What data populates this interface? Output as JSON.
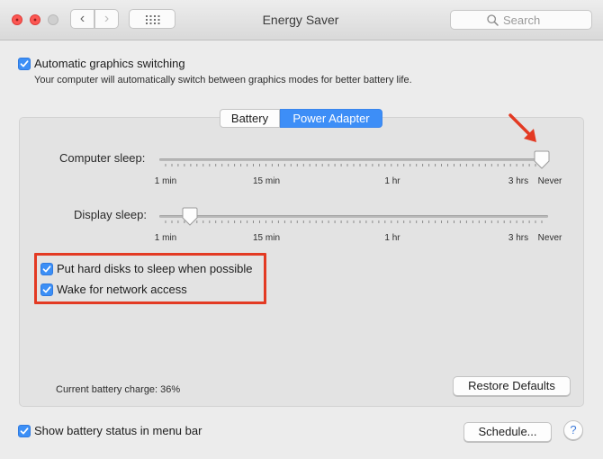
{
  "window": {
    "title": "Energy Saver",
    "search_placeholder": "Search"
  },
  "toolbar": {
    "back_glyph": "‹",
    "forward_glyph": "›",
    "grid_icon": "show-all-grid-icon"
  },
  "graphics_switching": {
    "label": "Automatic graphics switching",
    "checked": true,
    "description": "Your computer will automatically switch between graphics modes for better battery life."
  },
  "tabs": [
    {
      "label": "Battery",
      "selected": false
    },
    {
      "label": "Power Adapter",
      "selected": true
    }
  ],
  "sliders": {
    "computer_sleep": {
      "label": "Computer sleep:",
      "value": "Never",
      "ticks": [
        "1 min",
        "15 min",
        "1 hr",
        "3 hrs",
        "Never"
      ]
    },
    "display_sleep": {
      "label": "Display sleep:",
      "value": "approx. 5 min",
      "ticks": [
        "1 min",
        "15 min",
        "1 hr",
        "3 hrs",
        "Never"
      ]
    }
  },
  "options": [
    {
      "label": "Put hard disks to sleep when possible",
      "checked": true
    },
    {
      "label": "Wake for network access",
      "checked": true
    }
  ],
  "annotation_color": "#e33a23",
  "battery_charge": "Current battery charge: 36%",
  "buttons": {
    "restore_defaults": "Restore Defaults",
    "schedule": "Schedule...",
    "help": "?"
  },
  "menu_bar_status": {
    "label": "Show battery status in menu bar",
    "checked": true
  },
  "colors": {
    "accent": "#3d8ef7",
    "close": "#fc5753"
  }
}
